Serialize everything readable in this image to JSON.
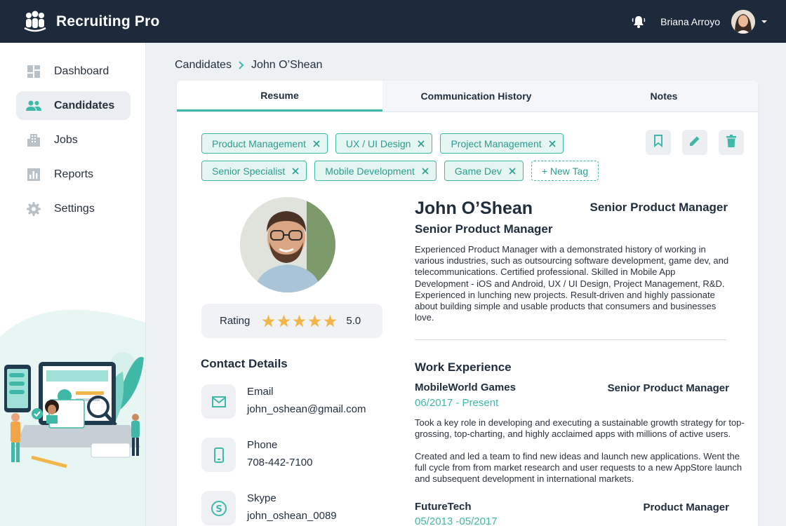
{
  "app": {
    "name": "Recruiting Pro",
    "logo_icon": "team-logo-icon",
    "colors": {
      "header_bg": "#1c2a3b",
      "accent": "#3fb8a8",
      "star": "#f2b54a"
    }
  },
  "header": {
    "user_name": "Briana Arroyo",
    "notification_icon": "bell-icon",
    "menu_icon": "chevron-down-icon"
  },
  "sidebar": {
    "items": [
      {
        "label": "Dashboard",
        "icon": "dashboard-icon",
        "active": false
      },
      {
        "label": "Candidates",
        "icon": "people-icon",
        "active": true
      },
      {
        "label": "Jobs",
        "icon": "building-icon",
        "active": false
      },
      {
        "label": "Reports",
        "icon": "bar-chart-icon",
        "active": false
      },
      {
        "label": "Settings",
        "icon": "gear-icon",
        "active": false
      }
    ]
  },
  "breadcrumb": {
    "parent": "Candidates",
    "current": "John O’Shean"
  },
  "tabs": [
    {
      "label": "Resume",
      "active": true
    },
    {
      "label": "Communication History",
      "active": false
    },
    {
      "label": "Notes",
      "active": false
    }
  ],
  "tags": [
    "Product Management",
    "UX / UI Design",
    "Project Management",
    "Senior Specialist",
    "Mobile Development",
    "Game Dev"
  ],
  "new_tag_label": "+ New Tag",
  "actions": [
    "bookmark-icon",
    "pencil-icon",
    "trash-icon"
  ],
  "profile": {
    "name": "John O’Shean",
    "position": "Senior Product Manager",
    "position_right": "Senior Product Manager",
    "summary": "Experienced Product Manager with a demonstrated history of working in various industries, such as outsourcing software development, game dev, and telecommunications. Certified professional. Skilled in Mobile App Development - iOS and Android, UX / UI Design, Project Management, R&D. Experienced in lunching new projects. Result-driven and highly passionate about building simple and usable products that consumers and businesses love.",
    "rating_label": "Rating",
    "rating_value": "5.0",
    "rating_stars": 5
  },
  "contact": {
    "title": "Contact Details",
    "items": [
      {
        "label": "Email",
        "value": "john_oshean@gmail.com",
        "icon": "mail-icon"
      },
      {
        "label": "Phone",
        "value": "708-442-7100",
        "icon": "phone-icon"
      },
      {
        "label": "Skype",
        "value": "john_oshean_0089",
        "icon": "skype-icon"
      }
    ]
  },
  "experience": {
    "title": "Work Experience",
    "jobs": [
      {
        "company": "MobileWorld Games",
        "role": "Senior Product Manager",
        "dates": "06/2017 - Present",
        "description_1": "Took a key role in developing and executing a sustainable growth strategy for top-grossing, top-charting, and highly acclaimed apps with millions of active users.",
        "description_2": "Created and led a team to find new ideas and launch new applications. Went the full cycle from  from market research and user requests to a new AppStore launch and subsequent development in international markets."
      },
      {
        "company": "FutureTech",
        "role": "Product Manager",
        "dates": "05/2013 -05/2017"
      }
    ]
  }
}
